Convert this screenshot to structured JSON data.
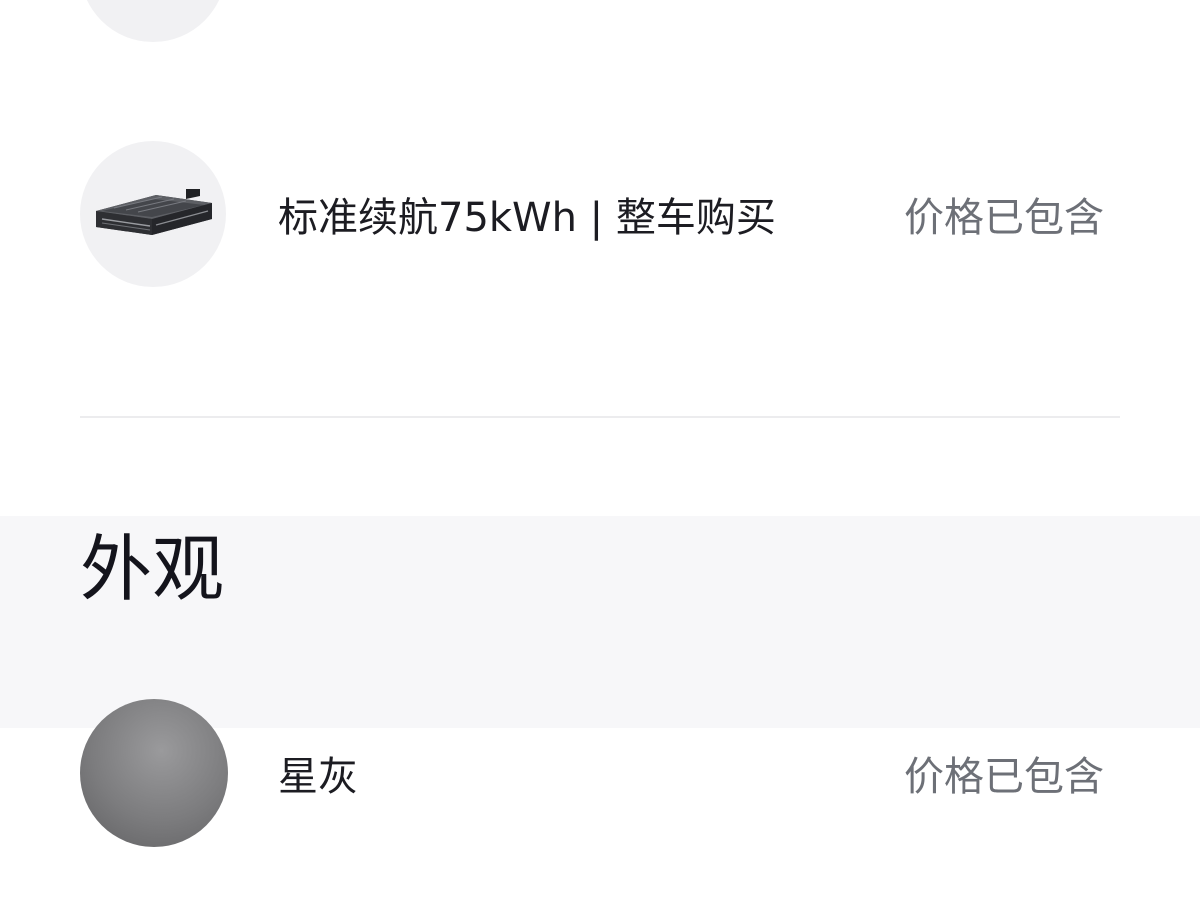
{
  "options": {
    "battery": {
      "label": "标准续航75kWh | 整车购买",
      "price_status": "价格已包含",
      "icon": "battery-pack-icon"
    }
  },
  "exterior": {
    "section_title": "外观",
    "color": {
      "label": "星灰",
      "price_status": "价格已包含",
      "swatch_color": "#7c7c7e"
    }
  }
}
